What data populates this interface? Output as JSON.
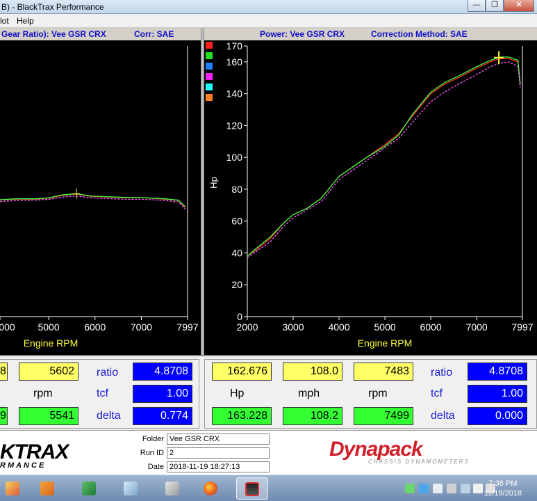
{
  "window": {
    "title": "B) - BlackTrax Performance"
  },
  "menu": {
    "items": [
      "lot",
      "Help"
    ]
  },
  "left_panel": {
    "header_left": "Gear Ratio): Vee GSR CRX",
    "header_right": "Corr: SAE",
    "xlabel": "Engine RPM"
  },
  "right_panel": {
    "header_left": "Power: Vee GSR CRX",
    "header_right": "Correction Method: SAE",
    "xlabel": "Engine RPM",
    "ylabel": "Hp"
  },
  "legend_colors": [
    "#ff2020",
    "#20e020",
    "#2080ff",
    "#ff20ff",
    "#20ffff",
    "#ff8020"
  ],
  "chart_data": [
    {
      "type": "line",
      "title": "",
      "xlabel": "Engine RPM",
      "ylabel": "",
      "x_ticks": [
        "000",
        "5000",
        "6000",
        "7000",
        "7997"
      ],
      "xlim": [
        3950,
        7997
      ],
      "series": [
        {
          "color": "#ff3030",
          "x": [
            3950,
            4300,
            4700,
            5000,
            5300,
            5600,
            5900,
            6300,
            6700,
            7100,
            7500,
            7800,
            7950
          ],
          "y": [
            0.62,
            0.625,
            0.625,
            0.63,
            0.645,
            0.652,
            0.64,
            0.636,
            0.632,
            0.632,
            0.625,
            0.618,
            0.58
          ]
        },
        {
          "color": "#40ff40",
          "x": [
            3950,
            4300,
            4700,
            5000,
            5300,
            5600,
            5900,
            6300,
            6700,
            7100,
            7500,
            7800,
            7950
          ],
          "y": [
            0.622,
            0.627,
            0.627,
            0.632,
            0.648,
            0.654,
            0.642,
            0.638,
            0.634,
            0.633,
            0.627,
            0.62,
            0.585
          ]
        },
        {
          "color": "#ff60ff",
          "x": [
            3950,
            4300,
            4700,
            5000,
            5300,
            5600,
            5900,
            6300,
            6700,
            7100,
            7500,
            7800,
            7950
          ],
          "y": [
            0.612,
            0.618,
            0.62,
            0.624,
            0.636,
            0.642,
            0.632,
            0.628,
            0.624,
            0.624,
            0.618,
            0.61,
            0.572
          ]
        }
      ]
    },
    {
      "type": "line",
      "title": "",
      "xlabel": "Engine RPM",
      "ylabel": "Hp",
      "x_ticks": [
        "2000",
        "3000",
        "4000",
        "5000",
        "6000",
        "7000",
        "7997"
      ],
      "y_ticks": [
        "0",
        "20",
        "40",
        "60",
        "80",
        "100",
        "120",
        "140",
        "160",
        "170"
      ],
      "xlim": [
        2000,
        7997
      ],
      "ylim": [
        0,
        170
      ],
      "series": [
        {
          "color": "#ff3030",
          "x": [
            2000,
            2200,
            2500,
            2800,
            3000,
            3300,
            3600,
            4000,
            4300,
            4600,
            5000,
            5300,
            5600,
            6000,
            6300,
            6600,
            7000,
            7300,
            7500,
            7700,
            7900,
            7950
          ],
          "y": [
            38,
            42,
            49,
            59,
            64,
            68,
            74,
            88,
            94,
            100,
            108,
            115,
            126,
            140,
            146,
            150,
            156,
            160,
            162,
            162,
            160,
            146
          ]
        },
        {
          "color": "#40ff40",
          "x": [
            2000,
            2200,
            2500,
            2800,
            3000,
            3300,
            3600,
            4000,
            4300,
            4600,
            5000,
            5300,
            5600,
            6000,
            6300,
            6600,
            7000,
            7300,
            7500,
            7700,
            7900,
            7950
          ],
          "y": [
            38,
            43,
            50,
            59,
            64,
            68,
            74,
            88,
            94,
            100,
            107,
            114,
            127,
            141,
            147,
            151,
            157,
            161,
            163,
            163,
            161,
            146
          ]
        },
        {
          "color": "#ff60ff",
          "x": [
            2000,
            2200,
            2500,
            2800,
            3000,
            3300,
            3600,
            4000,
            4300,
            4600,
            5000,
            5300,
            5600,
            6000,
            6300,
            6600,
            7000,
            7300,
            7500,
            7700,
            7900,
            7950
          ],
          "y": [
            37,
            41,
            47,
            57,
            62,
            67,
            72,
            86,
            92,
            98,
            106,
            112,
            122,
            135,
            141,
            146,
            152,
            157,
            159,
            160,
            157,
            144
          ]
        }
      ]
    }
  ],
  "readouts": {
    "left": {
      "top_partial": "8",
      "top_rpm": "5602",
      "rpm_label": "rpm",
      "bottom_partial": "9",
      "bottom_rpm": "5541",
      "ratio_label": "ratio",
      "ratio_value": "4.8708",
      "tcf_label": "tcf",
      "tcf_value": "1.00",
      "delta_label": "delta",
      "delta_value": "0.774"
    },
    "right": {
      "hp_top": "162.676",
      "mph_top": "108.0",
      "rpm_top": "7483",
      "hp_label": "Hp",
      "mph_label": "mph",
      "rpm_label": "rpm",
      "hp_bottom": "163.228",
      "mph_bottom": "108.2",
      "rpm_bottom": "7499",
      "ratio_label": "ratio",
      "ratio_value": "4.8708",
      "tcf_label": "tcf",
      "tcf_value": "1.00",
      "delta_label": "delta",
      "delta_value": "0.000"
    }
  },
  "run_info": {
    "folder_label": "Folder",
    "folder_value": "Vee GSR CRX",
    "runid_label": "Run ID",
    "runid_value": "2",
    "date_label": "Date",
    "date_value": "2018-11-19 18:27:13"
  },
  "brand": {
    "left_line1": "KTRAX",
    "left_line2": "RMANCE",
    "right_line1": "Dynapack",
    "right_line2": "CHASSIS DYNAMOMETERS"
  },
  "taskbar": {
    "time": "7:38 PM",
    "date": "11/19/2018",
    "app_icons": [
      "paint-icon",
      "media-player-icon",
      "excel-icon",
      "notepad-icon",
      "calculator-icon",
      "firefox-icon",
      "blacktrax-icon"
    ]
  }
}
